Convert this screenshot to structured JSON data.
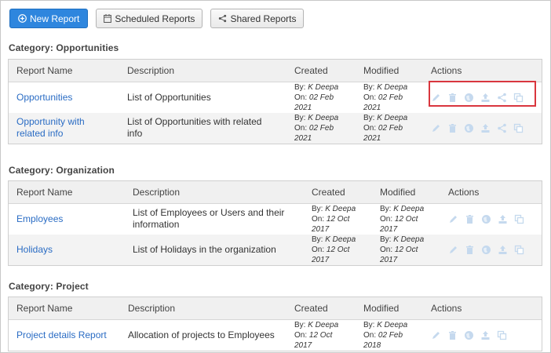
{
  "toolbar": {
    "new_report": "New Report",
    "scheduled_reports": "Scheduled Reports",
    "shared_reports": "Shared Reports"
  },
  "columns": {
    "report_name": "Report Name",
    "description": "Description",
    "created": "Created",
    "modified": "Modified",
    "actions": "Actions"
  },
  "categories": [
    {
      "title": "Category: Opportunities",
      "rows": [
        {
          "name": "Opportunities",
          "description": "List of Opportunities",
          "created_by": "K Deepa",
          "created_on": "02 Feb 2021",
          "modified_by": "K Deepa",
          "modified_on": "02 Feb 2021"
        },
        {
          "name": "Opportunity with related info",
          "description": "List of Opportunities with related info",
          "created_by": "K Deepa",
          "created_on": "02 Feb 2021",
          "modified_by": "K Deepa",
          "modified_on": "02 Feb 2021"
        }
      ]
    },
    {
      "title": "Category: Organization",
      "rows": [
        {
          "name": "Employees",
          "description": "List of Employees or Users and their information",
          "created_by": "K Deepa",
          "created_on": "12 Oct 2017",
          "modified_by": "K Deepa",
          "modified_on": "12 Oct 2017"
        },
        {
          "name": "Holidays",
          "description": "List of Holidays in the organization",
          "created_by": "K Deepa",
          "created_on": "12 Oct 2017",
          "modified_by": "K Deepa",
          "modified_on": "12 Oct 2017"
        }
      ]
    },
    {
      "title": "Category: Project",
      "rows": [
        {
          "name": "Project details Report",
          "description": "Allocation of projects to Employees",
          "created_by": "K Deepa",
          "created_on": "12 Oct 2017",
          "modified_by": "K Deepa",
          "modified_on": "02 Feb 2018"
        }
      ]
    }
  ],
  "labels": {
    "by": "By:",
    "on": "On:"
  },
  "icons": {
    "new_report": "plus-circle-icon",
    "scheduled_reports": "calendar-icon",
    "shared_reports": "share-icon",
    "actions": [
      "edit-icon",
      "delete-icon",
      "globe-icon",
      "export-icon",
      "share-icon",
      "copy-icon"
    ]
  },
  "colors": {
    "primary": "#2e86de",
    "link": "#2a6cc4",
    "icon_muted": "#c5d9ee",
    "icon_active": "#b7cde6",
    "highlight": "#d9363e"
  }
}
